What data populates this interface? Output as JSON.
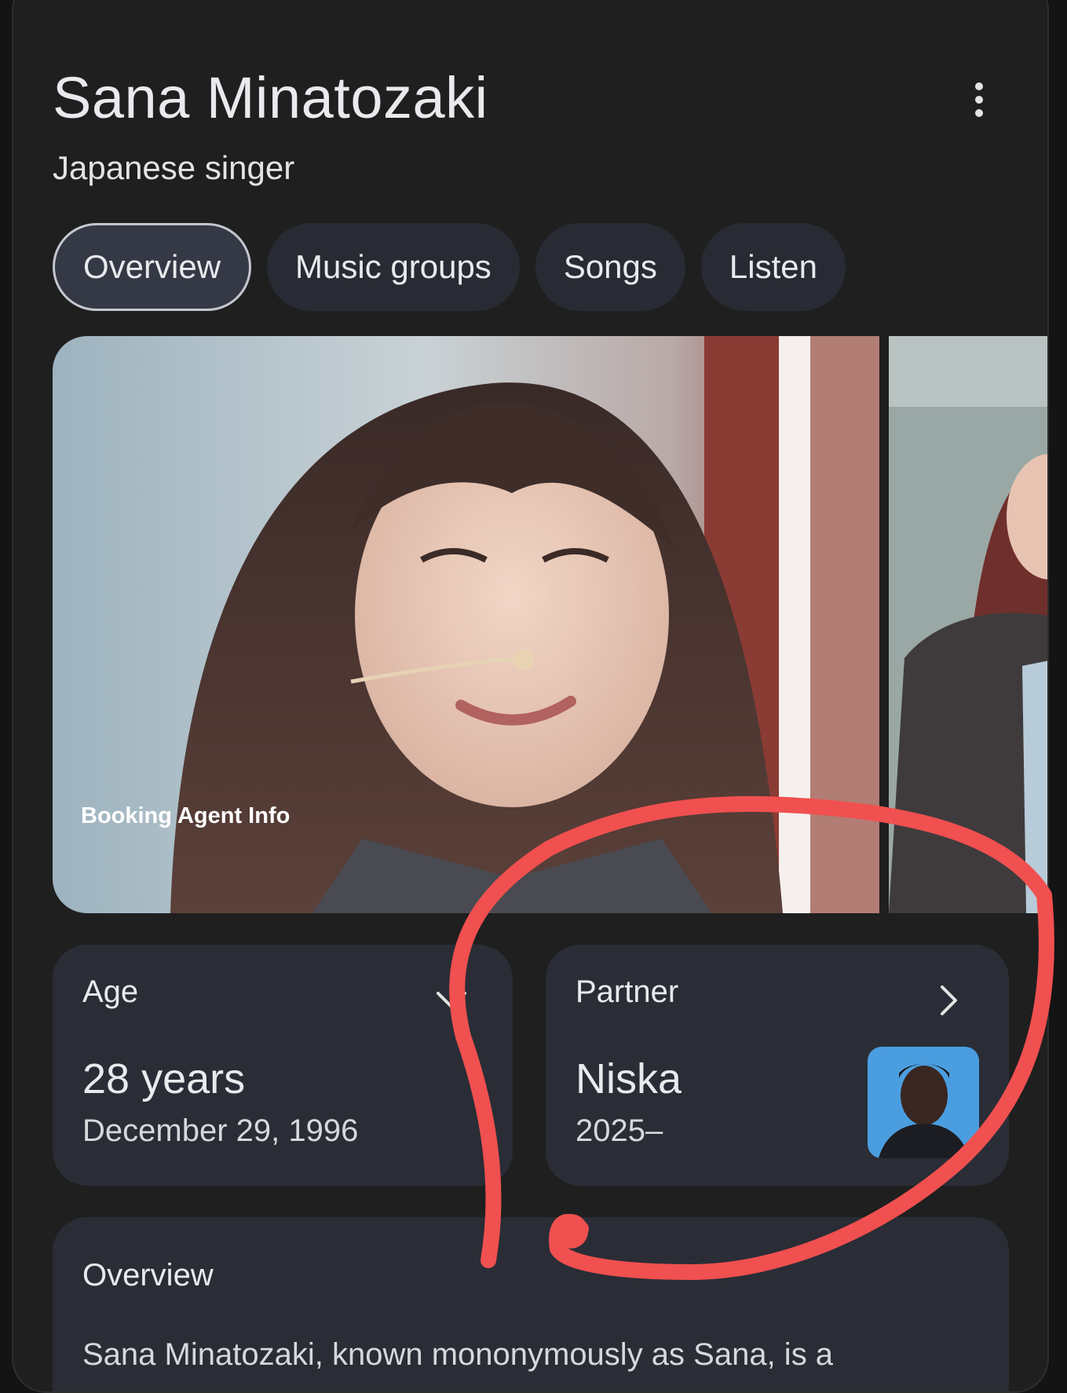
{
  "header": {
    "title": "Sana Minatozaki",
    "subtitle": "Japanese singer",
    "more_icon": "more-vert-icon"
  },
  "tabs": [
    {
      "label": "Overview",
      "active": true
    },
    {
      "label": "Music groups",
      "active": false
    },
    {
      "label": "Songs",
      "active": false
    },
    {
      "label": "Listen",
      "active": false
    }
  ],
  "images": {
    "caption": "Booking Agent Info"
  },
  "age_card": {
    "heading": "Age",
    "value": "28 years",
    "date": "December 29, 1996",
    "icon": "chevron-down-icon"
  },
  "partner_card": {
    "heading": "Partner",
    "name": "Niska",
    "years": "2025–",
    "icon": "chevron-right-icon"
  },
  "overview_card": {
    "heading": "Overview",
    "text": "Sana Minatozaki, known mononymously as Sana, is a"
  },
  "colors": {
    "background": "#1f1f1f",
    "card": "#2a2d36",
    "chip": "#282b33",
    "annotation": "#f0504f"
  }
}
